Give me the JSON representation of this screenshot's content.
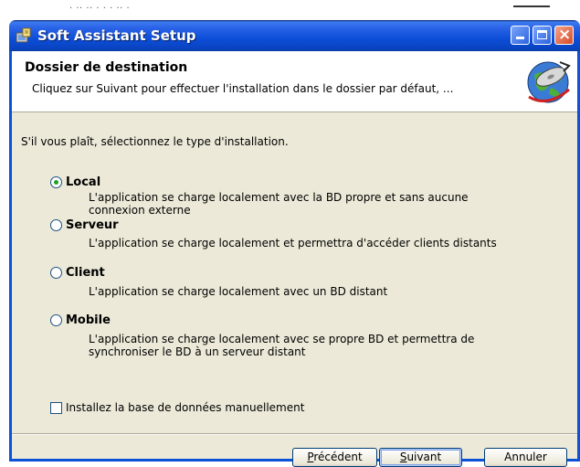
{
  "background_window": {
    "title_fragment": "· ·· ·· · · · ·· ·"
  },
  "window": {
    "title": "Soft Assistant Setup",
    "controls": {
      "minimize": "minimize",
      "maximize": "maximize",
      "close": "×"
    }
  },
  "header": {
    "title": "Dossier de destination",
    "subtitle": "Cliquez sur Suivant pour effectuer l'installation dans le dossier par défaut, ..."
  },
  "body": {
    "prompt": "S'il vous plaît, sélectionnez le type d'installation.",
    "options": [
      {
        "label": "Local",
        "selected": true,
        "description": "L'application se charge localement avec la BD propre et sans aucune connexion externe"
      },
      {
        "label": "Serveur",
        "selected": false,
        "description": "L'application se charge localement et permettra d'accéder clients distants"
      },
      {
        "label": "Client",
        "selected": false,
        "description": "L'application se charge localement avec un BD distant"
      },
      {
        "label": "Mobile",
        "selected": false,
        "description": "L'application se charge localement avec se propre BD et permettra de synchroniser le BD à un serveur distant"
      }
    ],
    "checkbox": {
      "label": "Installez la base de données manuellement",
      "checked": false
    }
  },
  "buttons": {
    "back": {
      "mnemonic": "P",
      "rest": "récédent"
    },
    "next": {
      "mnemonic": "S",
      "rest": "uivant"
    },
    "cancel": "Annuler"
  },
  "colors": {
    "titlebar": "#0a43c2",
    "dialog_bg": "#ece9d8",
    "radio_dot": "#21a121"
  }
}
